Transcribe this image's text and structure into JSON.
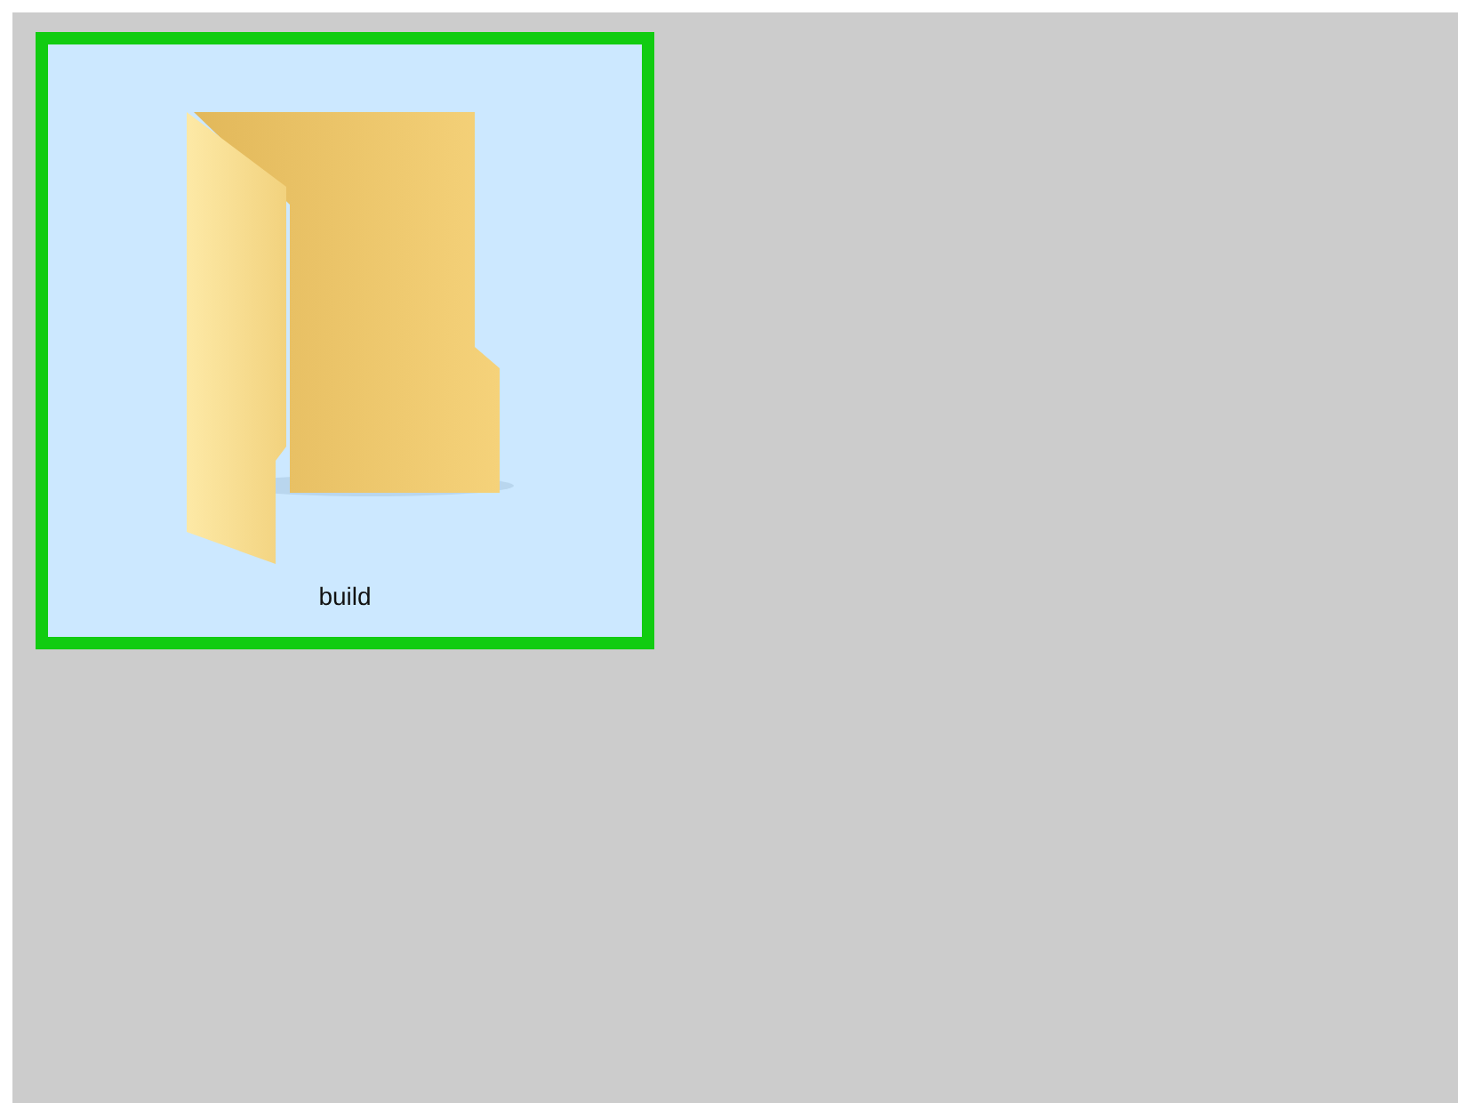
{
  "items": [
    {
      "label": "build",
      "selected": true,
      "highlighted": true
    }
  ]
}
